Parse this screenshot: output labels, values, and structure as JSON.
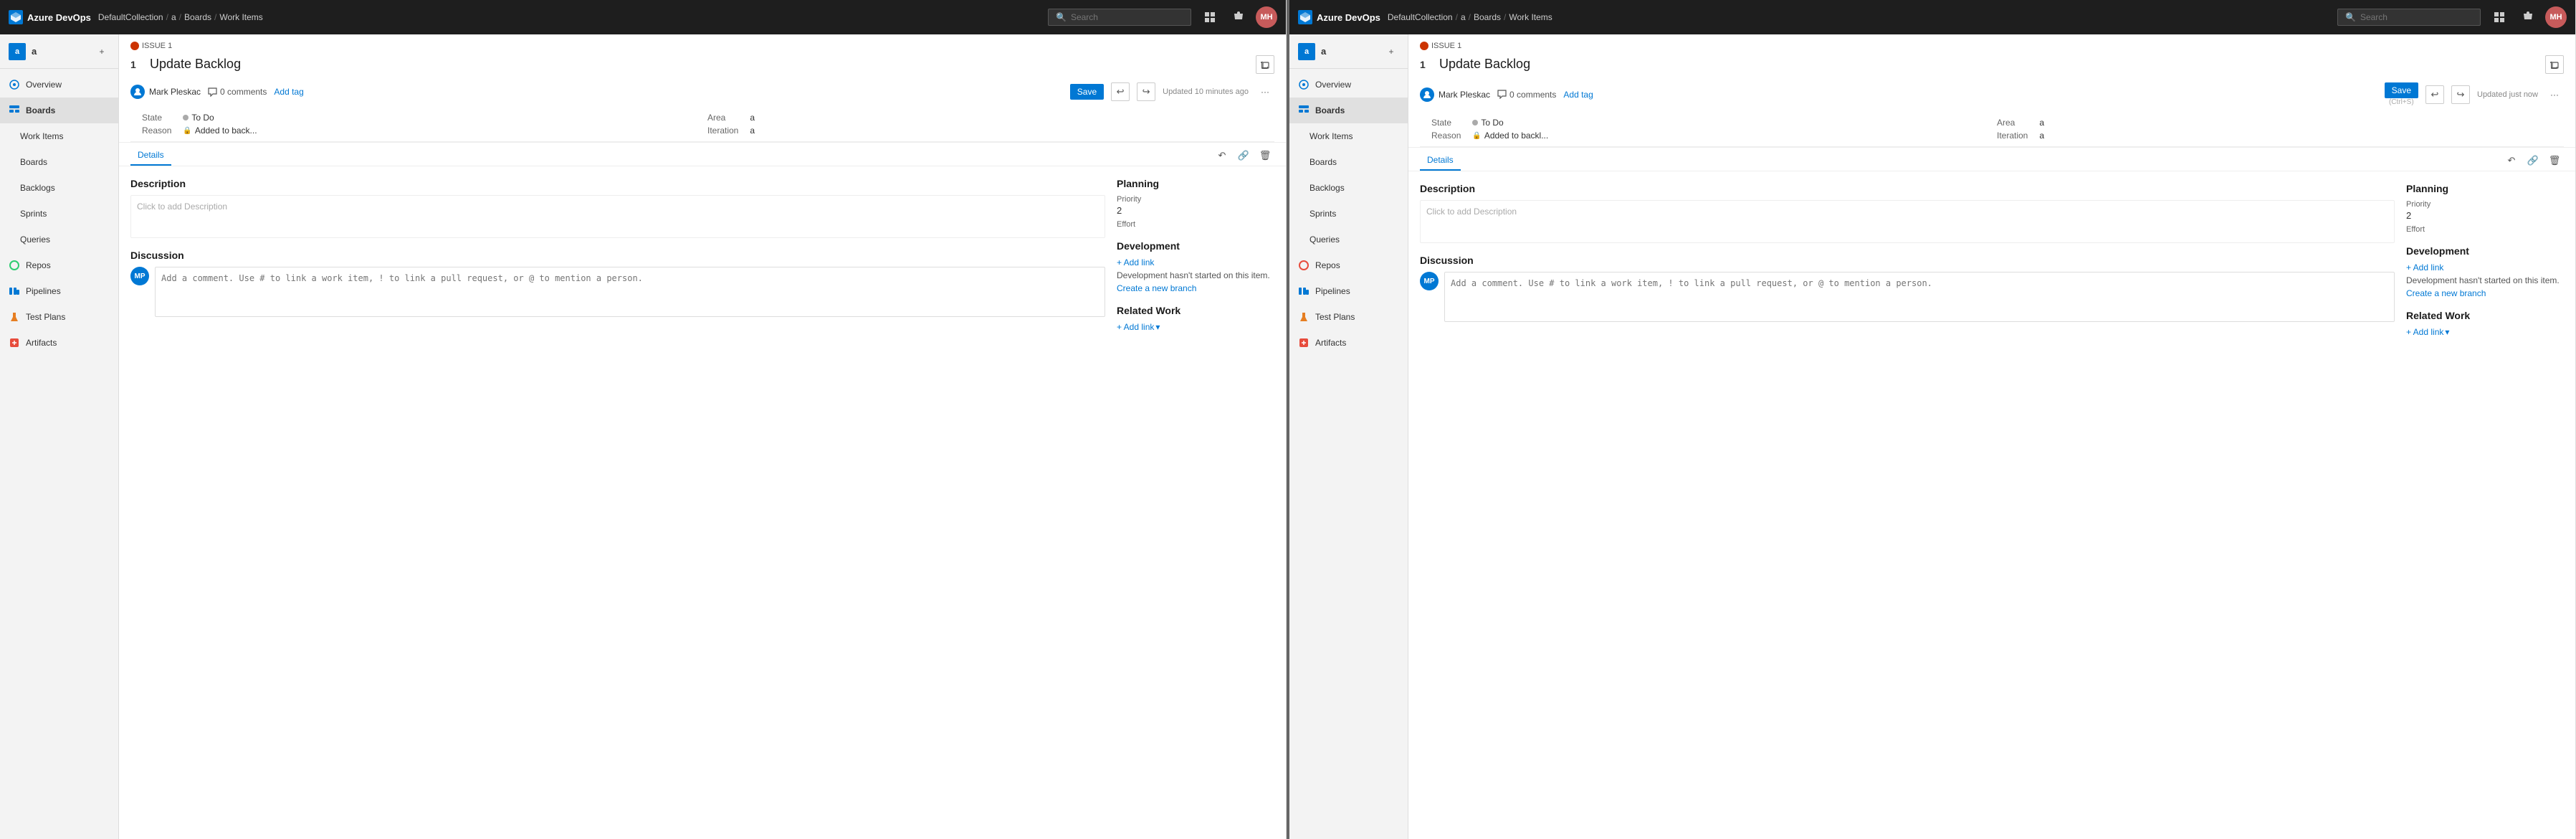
{
  "panel1": {
    "topbar": {
      "logo": "Azure DevOps",
      "breadcrumb": [
        "DefaultCollection",
        "a",
        "Boards",
        "Work Items"
      ],
      "search_placeholder": "Search",
      "avatar_initials": "MH"
    },
    "sidebar": {
      "org_name": "a",
      "org_avatar": "a",
      "items": [
        {
          "id": "overview",
          "label": "Overview",
          "icon": "overview"
        },
        {
          "id": "boards",
          "label": "Boards",
          "icon": "boards",
          "active": true
        },
        {
          "id": "workitems",
          "label": "Work Items",
          "icon": "workitems",
          "active": false
        },
        {
          "id": "boards2",
          "label": "Boards",
          "icon": "boards2"
        },
        {
          "id": "backlogs",
          "label": "Backlogs",
          "icon": "backlogs"
        },
        {
          "id": "sprints",
          "label": "Sprints",
          "icon": "sprints"
        },
        {
          "id": "queries",
          "label": "Queries",
          "icon": "queries"
        },
        {
          "id": "repos",
          "label": "Repos",
          "icon": "repos"
        },
        {
          "id": "pipelines",
          "label": "Pipelines",
          "icon": "pipelines"
        },
        {
          "id": "testplans",
          "label": "Test Plans",
          "icon": "testplans"
        },
        {
          "id": "artifacts",
          "label": "Artifacts",
          "icon": "artifacts"
        }
      ]
    },
    "workitem": {
      "issue_label": "ISSUE 1",
      "number": "1",
      "title": "Update Backlog",
      "assignee": "Mark Pleskac",
      "assignee_initials": "MP",
      "comments_count": "0 comments",
      "add_tag": "Add tag",
      "state_label": "State",
      "state_value": "To Do",
      "area_label": "Area",
      "area_value": "a",
      "reason_label": "Reason",
      "reason_value": "Added to back...",
      "iteration_label": "Iteration",
      "iteration_value": "a",
      "updated": "Updated 10 minutes ago",
      "details_tab": "Details",
      "description_title": "Description",
      "description_placeholder": "Click to add Description",
      "discussion_title": "Discussion",
      "comment_placeholder": "Add a comment. Use # to link a work item, ! to link a pull request, or @ to mention a person.",
      "comment_avatar_initials": "MP",
      "planning_title": "Planning",
      "priority_label": "Priority",
      "priority_value": "2",
      "effort_label": "Effort",
      "effort_value": "",
      "development_title": "Development",
      "add_link": "+ Add link",
      "dev_not_started": "Development hasn't started on this item.",
      "create_branch": "Create a new branch",
      "related_work_title": "Related Work",
      "related_add_link": "+ Add link"
    }
  },
  "panel2": {
    "topbar": {
      "logo": "Azure DevOps",
      "breadcrumb": [
        "DefaultCollection",
        "a",
        "Boards",
        "Work Items"
      ],
      "search_placeholder": "Search",
      "avatar_initials": "MH"
    },
    "sidebar": {
      "org_name": "a",
      "org_avatar": "a",
      "items": [
        {
          "id": "overview",
          "label": "Overview",
          "icon": "overview"
        },
        {
          "id": "boards",
          "label": "Boards",
          "icon": "boards",
          "active": true
        },
        {
          "id": "workitems",
          "label": "Work Items",
          "icon": "workitems"
        },
        {
          "id": "boards2",
          "label": "Boards",
          "icon": "boards2"
        },
        {
          "id": "backlogs",
          "label": "Backlogs",
          "icon": "backlogs"
        },
        {
          "id": "sprints",
          "label": "Sprints",
          "icon": "sprints"
        },
        {
          "id": "queries",
          "label": "Queries",
          "icon": "queries"
        },
        {
          "id": "repos",
          "label": "Repos",
          "icon": "repos"
        },
        {
          "id": "pipelines",
          "label": "Pipelines",
          "icon": "pipelines"
        },
        {
          "id": "testplans",
          "label": "Test Plans",
          "icon": "testplans"
        },
        {
          "id": "artifacts",
          "label": "Artifacts",
          "icon": "artifacts"
        }
      ]
    },
    "workitem": {
      "issue_label": "ISSUE 1",
      "number": "1",
      "title": "Update Backlog",
      "assignee": "Mark Pleskac",
      "assignee_initials": "MP",
      "comments_count": "0 comments",
      "add_tag": "Add tag",
      "state_label": "State",
      "state_value": "To Do",
      "area_label": "Area",
      "area_value": "a",
      "reason_label": "Reason",
      "reason_value": "Added to backl...",
      "iteration_label": "Iteration",
      "iteration_value": "a",
      "updated": "Updated just now",
      "save_label": "Save",
      "save_shortcut": "(Ctrl+S)",
      "details_tab": "Details",
      "description_title": "Description",
      "description_placeholder": "Click to add Description",
      "discussion_title": "Discussion",
      "comment_placeholder": "Add a comment. Use # to link a work item, ! to link a pull request, or @ to mention a person.",
      "comment_avatar_initials": "MP",
      "planning_title": "Planning",
      "priority_label": "Priority",
      "priority_value": "2",
      "effort_label": "Effort",
      "effort_value": "",
      "development_title": "Development",
      "add_link": "+ Add link",
      "dev_not_started": "Development hasn't started on this item.",
      "create_branch": "Create a new branch",
      "related_work_title": "Related Work",
      "related_add_link": "+ Add link"
    }
  }
}
